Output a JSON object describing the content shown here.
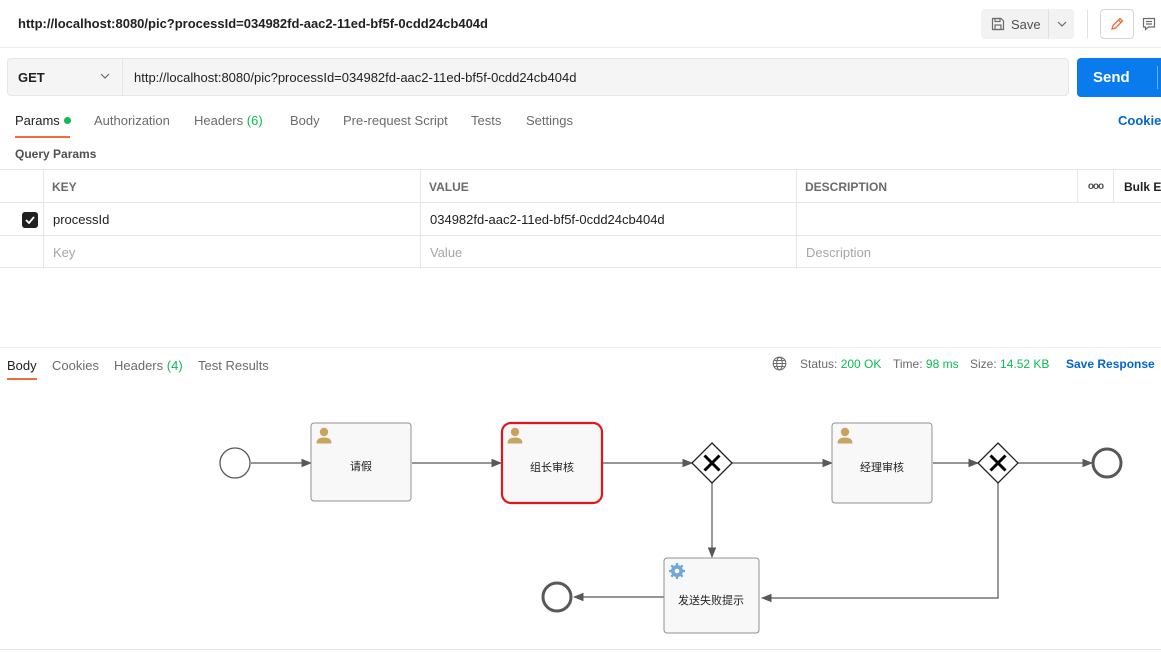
{
  "titlebar": {
    "title": "http://localhost:8080/pic?processId=034982fd-aac2-11ed-bf5f-0cdd24cb404d",
    "save_label": "Save"
  },
  "request": {
    "method": "GET",
    "url": "http://localhost:8080/pic?processId=034982fd-aac2-11ed-bf5f-0cdd24cb404d",
    "send_label": "Send"
  },
  "request_tabs": {
    "params": "Params",
    "authorization": "Authorization",
    "headers": "Headers",
    "headers_count": "(6)",
    "body": "Body",
    "prerequest": "Pre-request Script",
    "tests": "Tests",
    "settings": "Settings",
    "cookies": "Cookies"
  },
  "query_params": {
    "label": "Query Params",
    "headers": {
      "key": "KEY",
      "value": "VALUE",
      "description": "DESCRIPTION",
      "more": "ooo",
      "bulk": "Bulk Edit"
    },
    "rows": [
      {
        "key": "processId",
        "value": "034982fd-aac2-11ed-bf5f-0cdd24cb404d",
        "description": ""
      }
    ],
    "placeholders": {
      "key": "Key",
      "value": "Value",
      "description": "Description"
    }
  },
  "response_tabs": {
    "body": "Body",
    "cookies": "Cookies",
    "headers": "Headers",
    "headers_count": "(4)",
    "test_results": "Test Results"
  },
  "response_status": {
    "status_label": "Status:",
    "status_value": "200 OK",
    "time_label": "Time:",
    "time_value": "98 ms",
    "size_label": "Size:",
    "size_value": "14.52 KB",
    "save_response": "Save Response"
  },
  "diagram": {
    "tasks": {
      "leave": "请假",
      "leader_review": "组长审核",
      "manager_review": "经理审核",
      "send_failure": "发送失败提示"
    },
    "colors": {
      "highlight": "#e0161c",
      "task_fill": "#f8f8f8",
      "task_stroke": "#909090"
    }
  }
}
